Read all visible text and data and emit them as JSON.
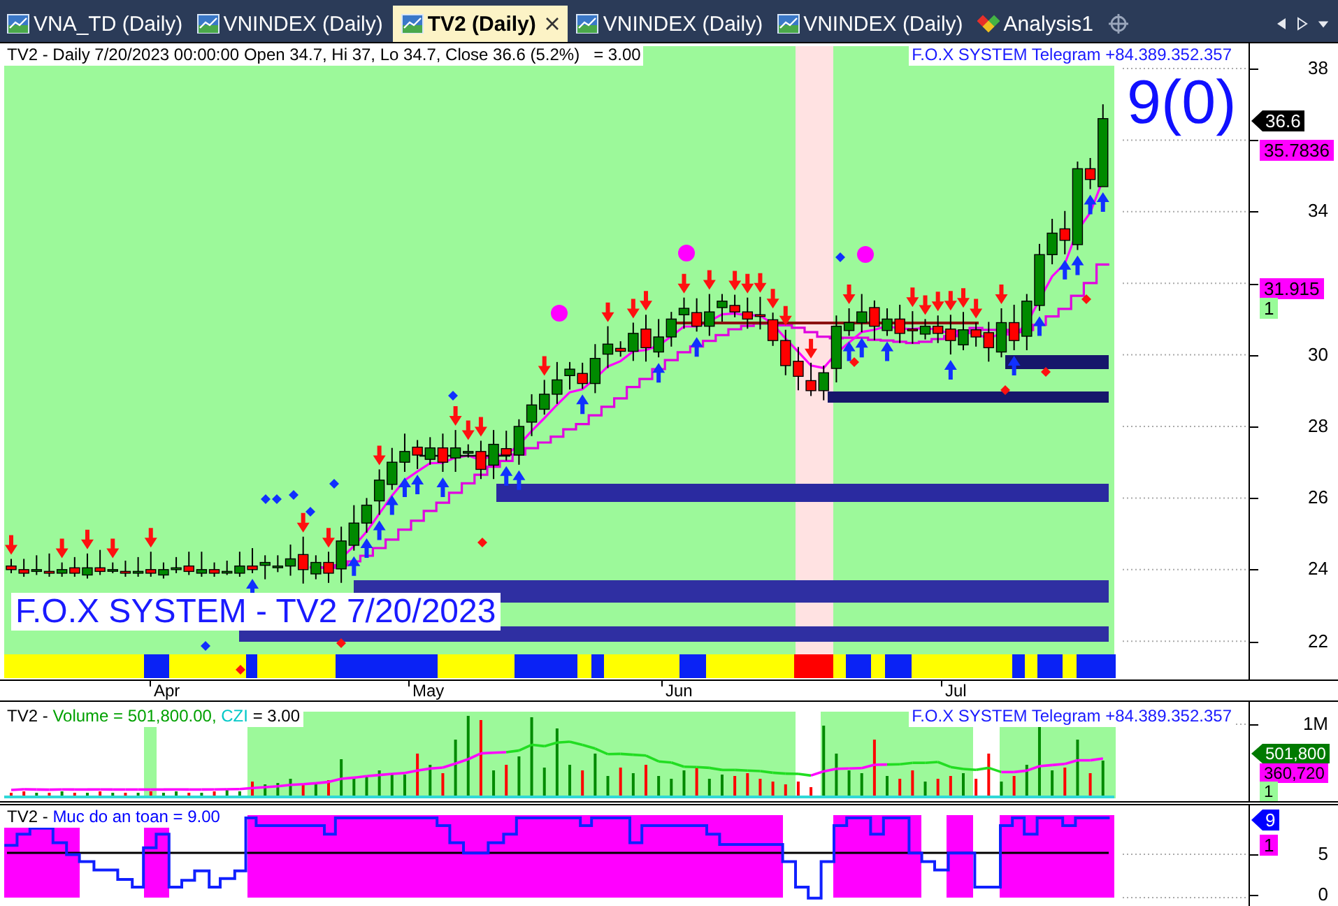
{
  "tabs": [
    {
      "label": "VNA_TD (Daily)",
      "kind": "chart",
      "selected": false
    },
    {
      "label": "VNINDEX (Daily)",
      "kind": "chart",
      "selected": false
    },
    {
      "label": "TV2 (Daily)",
      "kind": "chart",
      "selected": true
    },
    {
      "label": "VNINDEX (Daily)",
      "kind": "chart",
      "selected": false
    },
    {
      "label": "VNINDEX (Daily)",
      "kind": "chart",
      "selected": false
    },
    {
      "label": "Analysis1",
      "kind": "analysis",
      "selected": false
    }
  ],
  "price_pane": {
    "header": "TV2 - Daily 7/20/2023 00:00:00 Open 34.7, Hi 37, Lo 34.7, Close 36.6 (5.2%)   = 3.00",
    "contact": "F.O.X SYSTEM Telegram +84.389.352.357",
    "signal_count": "9(0)",
    "chart_label": "F.O.X SYSTEM - TV2 7/20/2023",
    "ticks": [
      "38",
      "34",
      "30",
      "28",
      "26",
      "24",
      "22"
    ],
    "tags": [
      {
        "text": "36.6",
        "kind": "pointer",
        "color": "#000000"
      },
      {
        "text": "35.7836",
        "kind": "box",
        "color": "#ff00ff"
      },
      {
        "text": "31.915",
        "kind": "box",
        "color": "#ff00ff"
      },
      {
        "text": "1",
        "kind": "box",
        "color": "#98fb98"
      }
    ]
  },
  "time_axis": {
    "months": [
      "Apr",
      "May",
      "Jun",
      "Jul"
    ]
  },
  "volume_pane": {
    "legend": [
      {
        "text": "TV2 -",
        "color": "#000000"
      },
      {
        "text": "Volume = 501,800.00,",
        "color": "#00a000"
      },
      {
        "text": "CZI",
        "color": "#00c8c8"
      },
      {
        "text": "= 3.00",
        "color": "#000000"
      }
    ],
    "contact": "F.O.X SYSTEM Telegram +84.389.352.357",
    "ticks": [
      "1M"
    ],
    "tags": [
      {
        "text": "501,800",
        "kind": "pointer",
        "color": "#007a00"
      },
      {
        "text": "360,720",
        "kind": "box",
        "color": "#ff00ff"
      },
      {
        "text": "1",
        "kind": "box",
        "color": "#98fb98"
      }
    ]
  },
  "safety_pane": {
    "legend": [
      {
        "text": "TV2 -",
        "color": "#000000"
      },
      {
        "text": "Muc do an toan = 9.00",
        "color": "#0000ff"
      }
    ],
    "ticks": [
      "5",
      "0"
    ],
    "tags": [
      {
        "text": "9",
        "kind": "pointer",
        "color": "#0000ff"
      },
      {
        "text": "1",
        "kind": "box",
        "color": "#ff00ff"
      }
    ]
  }
}
